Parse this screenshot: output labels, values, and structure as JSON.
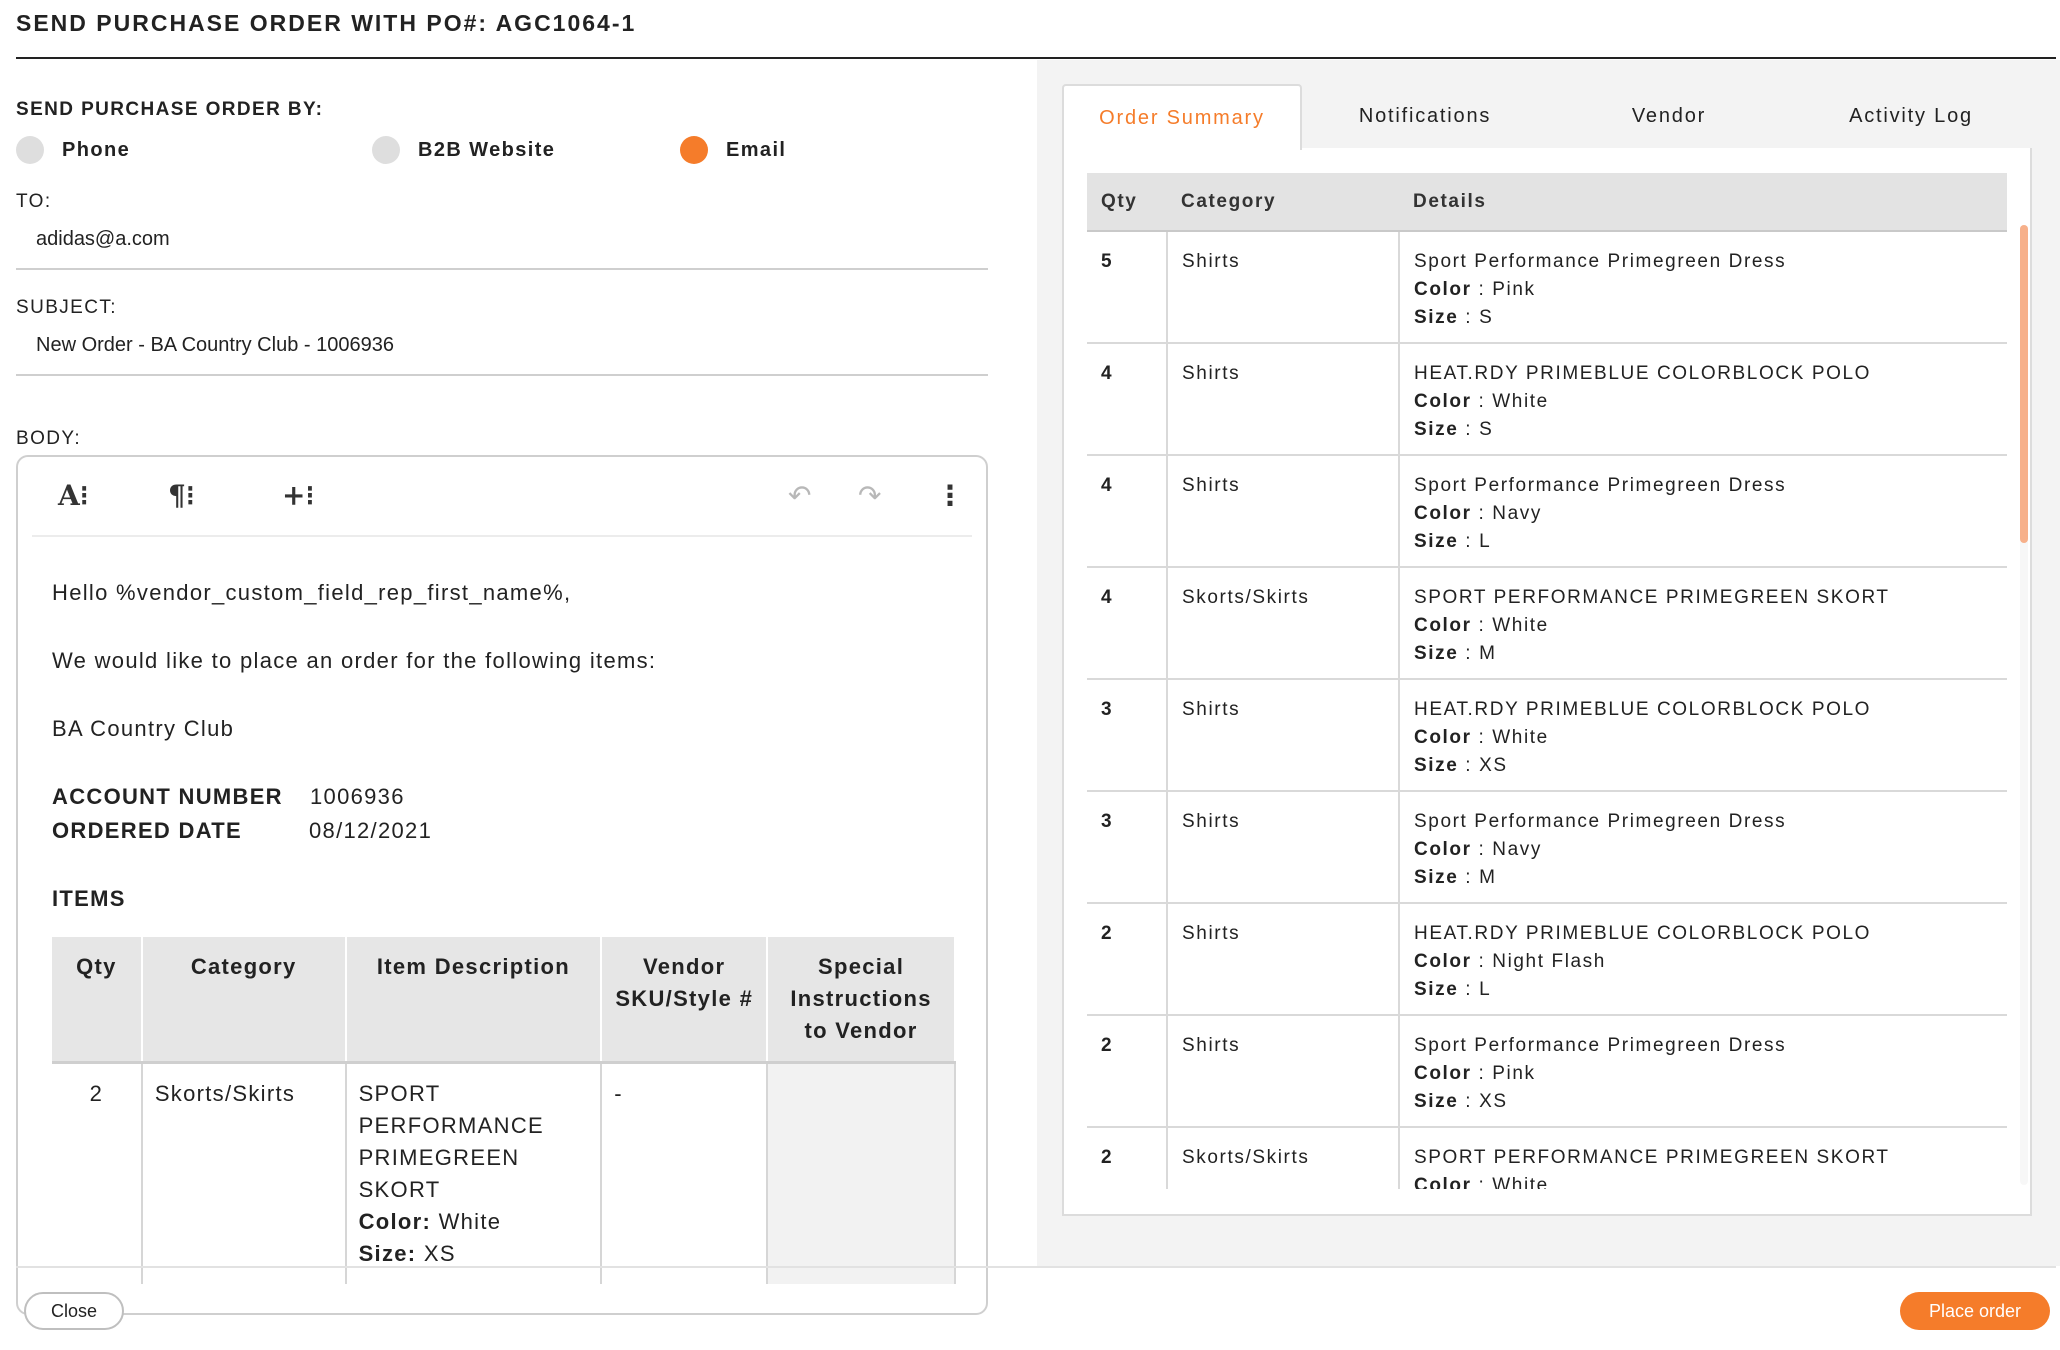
{
  "title": "SEND PURCHASE ORDER WITH PO#: AGC1064-1",
  "send_by": {
    "label": "SEND PURCHASE ORDER BY:",
    "options": [
      {
        "label": "Phone",
        "selected": false
      },
      {
        "label": "B2B Website",
        "selected": false
      },
      {
        "label": "Email",
        "selected": true
      }
    ]
  },
  "to": {
    "label": "TO:",
    "value": "adidas@a.com"
  },
  "subject": {
    "label": "SUBJECT:",
    "value": "New Order - BA Country Club - 1006936"
  },
  "body": {
    "label": "BODY:",
    "toolbar": {
      "font": "A⁝",
      "paragraph": "¶⁝",
      "insert": "+⁝",
      "undo": "↶",
      "redo": "↷",
      "more": "⋮"
    },
    "greeting": "Hello %vendor_custom_field_rep_first_name%,",
    "intro": "We would like to place an order for the following items:",
    "club": "BA Country Club",
    "account_label": "ACCOUNT NUMBER",
    "account_value": "1006936",
    "date_label": "ORDERED DATE",
    "date_value": "08/12/2021",
    "items_heading": "ITEMS",
    "items_table": {
      "headers": [
        "Qty",
        "Category",
        "Item Description",
        "Vendor SKU/Style #",
        "Special Instructions to Vendor"
      ],
      "rows": [
        {
          "qty": "2",
          "category": "Skorts/Skirts",
          "description": "SPORT PERFORMANCE PRIMEGREEN SKORT",
          "color_label": "Color:",
          "color": "White",
          "size_label": "Size:",
          "size": "XS",
          "sku": "-",
          "instructions": ""
        }
      ]
    }
  },
  "tabs": [
    {
      "label": "Order Summary",
      "active": true
    },
    {
      "label": "Notifications",
      "active": false
    },
    {
      "label": "Vendor",
      "active": false
    },
    {
      "label": "Activity Log",
      "active": false
    }
  ],
  "summary": {
    "headers": [
      "Qty",
      "Category",
      "Details"
    ],
    "color_label": "Color",
    "size_label": "Size",
    "rows": [
      {
        "qty": "5",
        "category": "Shirts",
        "name": "Sport Performance Primegreen Dress",
        "color": "Pink",
        "size": "S"
      },
      {
        "qty": "4",
        "category": "Shirts",
        "name": "HEAT.RDY PRIMEBLUE COLORBLOCK POLO",
        "color": "White",
        "size": "S"
      },
      {
        "qty": "4",
        "category": "Shirts",
        "name": "Sport Performance Primegreen Dress",
        "color": "Navy",
        "size": "L"
      },
      {
        "qty": "4",
        "category": "Skorts/Skirts",
        "name": "SPORT PERFORMANCE PRIMEGREEN SKORT",
        "color": "White",
        "size": "M"
      },
      {
        "qty": "3",
        "category": "Shirts",
        "name": "HEAT.RDY PRIMEBLUE COLORBLOCK POLO",
        "color": "White",
        "size": "XS"
      },
      {
        "qty": "3",
        "category": "Shirts",
        "name": "Sport Performance Primegreen Dress",
        "color": "Navy",
        "size": "M"
      },
      {
        "qty": "2",
        "category": "Shirts",
        "name": "HEAT.RDY PRIMEBLUE COLORBLOCK POLO",
        "color": "Night Flash",
        "size": "L"
      },
      {
        "qty": "2",
        "category": "Shirts",
        "name": "Sport Performance Primegreen Dress",
        "color": "Pink",
        "size": "XS"
      },
      {
        "qty": "2",
        "category": "Skorts/Skirts",
        "name": "SPORT PERFORMANCE PRIMEGREEN SKORT",
        "color": "White",
        "size": ""
      }
    ]
  },
  "footer": {
    "close_label": "Close",
    "place_label": "Place order"
  },
  "colors": {
    "accent": "#f57c2a",
    "radio_off": "#dedede",
    "header_bg": "#e3e3e3"
  }
}
